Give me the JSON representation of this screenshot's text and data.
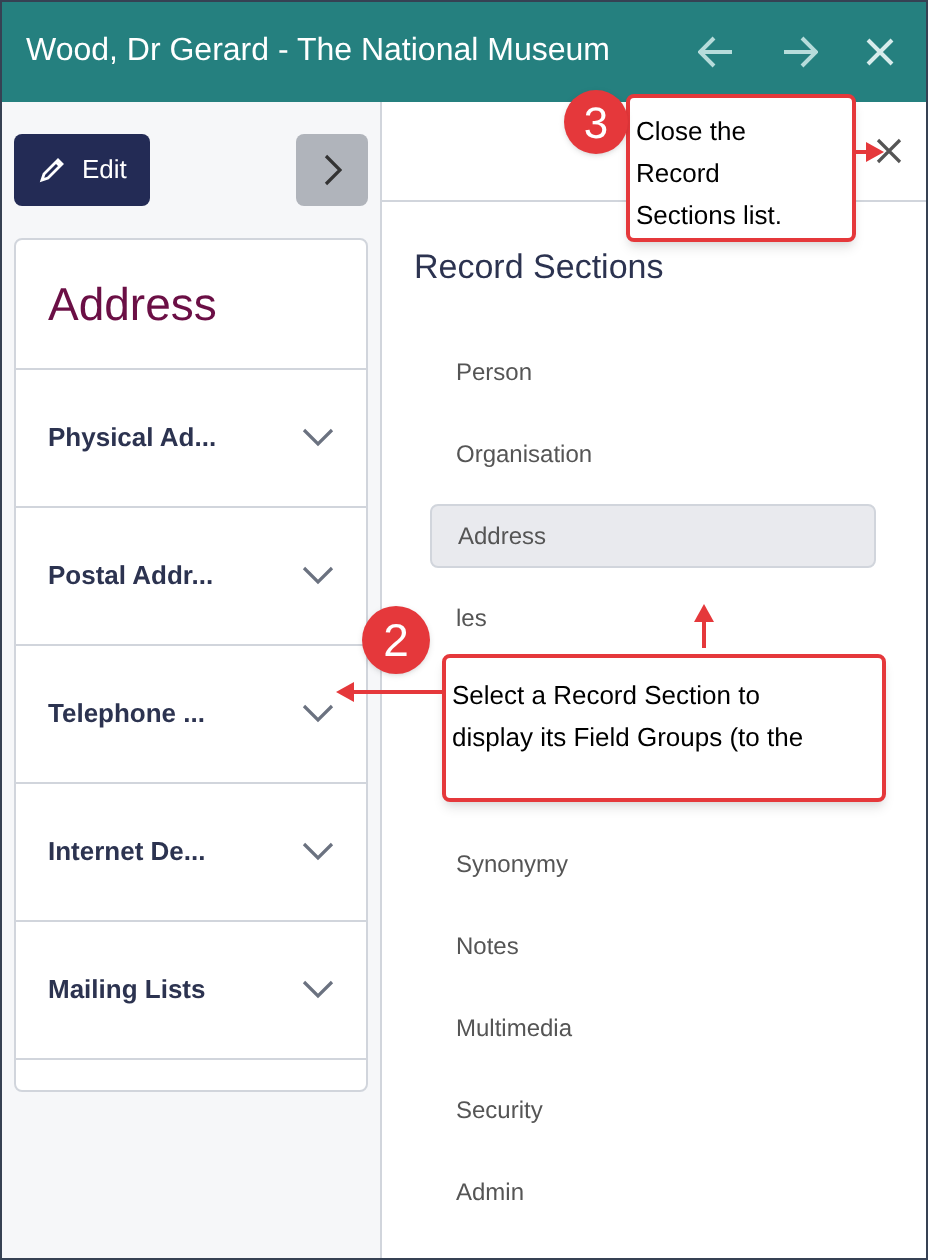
{
  "window": {
    "title": "Wood, Dr Gerard - The National Museum"
  },
  "edit_button": {
    "label": "Edit"
  },
  "panel": {
    "title": "Address",
    "groups": [
      {
        "label": "Physical Ad...",
        "expanded": false
      },
      {
        "label": "Postal Addr...",
        "expanded": false
      },
      {
        "label": "Telephone ...",
        "expanded": false
      },
      {
        "label": "Internet De...",
        "expanded": false
      },
      {
        "label": "Mailing Lists",
        "expanded": false
      }
    ]
  },
  "record_sections": {
    "title": "Record Sections",
    "items": [
      {
        "label": "Person",
        "selected": false
      },
      {
        "label": "Organisation",
        "selected": false
      },
      {
        "label": "Address",
        "selected": true
      },
      {
        "label": "les",
        "selected": false
      },
      {
        "label": "Synonymy",
        "selected": false
      },
      {
        "label": "Notes",
        "selected": false
      },
      {
        "label": "Multimedia",
        "selected": false
      },
      {
        "label": "Security",
        "selected": false
      },
      {
        "label": "Admin",
        "selected": false
      }
    ]
  },
  "callouts": [
    {
      "number": "3",
      "text": "Close the Record Sections list."
    },
    {
      "number": "2",
      "text": "Select a Record Section to display its Field Groups (to the"
    }
  ]
}
